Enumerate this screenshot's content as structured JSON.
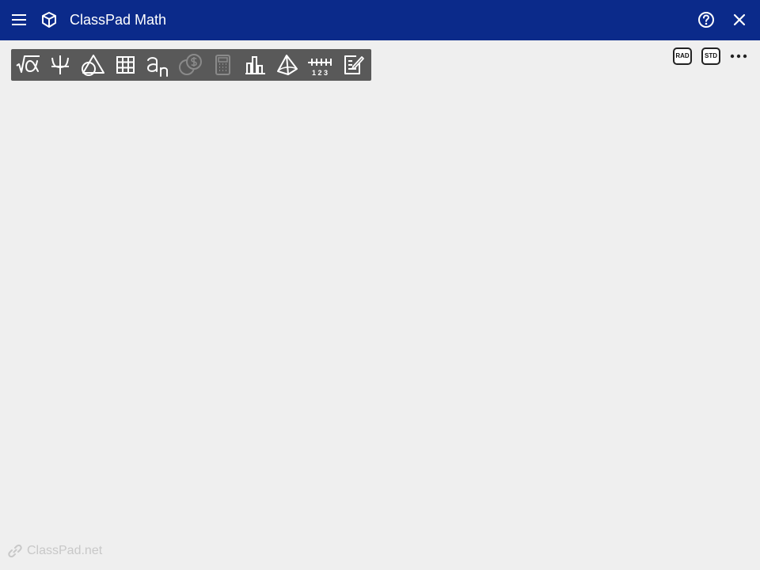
{
  "app": {
    "title": "ClassPad Math"
  },
  "header": {
    "menu_icon": "hamburger-menu-icon",
    "logo_icon": "classpad-cube-icon",
    "help_icon": "help-circle-icon",
    "close_icon": "close-icon"
  },
  "toolbar": {
    "items": [
      {
        "name": "math-sqrt-alpha",
        "enabled": true
      },
      {
        "name": "graph-psi",
        "enabled": true
      },
      {
        "name": "geometry",
        "enabled": true
      },
      {
        "name": "table",
        "enabled": true
      },
      {
        "name": "sequence-an",
        "enabled": true
      },
      {
        "name": "financial",
        "enabled": false
      },
      {
        "name": "calculator",
        "enabled": false
      },
      {
        "name": "statistics",
        "enabled": true
      },
      {
        "name": "3d-geometry",
        "enabled": true
      },
      {
        "name": "number-line",
        "enabled": true,
        "label": "1 2 3"
      },
      {
        "name": "notes-edit",
        "enabled": true
      }
    ]
  },
  "modes": {
    "angle": "RAD",
    "display": "STD"
  },
  "footer": {
    "text": "ClassPad.net",
    "icon": "link-icon"
  },
  "colors": {
    "header": "#0b2a8a",
    "toolbar": "#595959",
    "background": "#efefef"
  }
}
